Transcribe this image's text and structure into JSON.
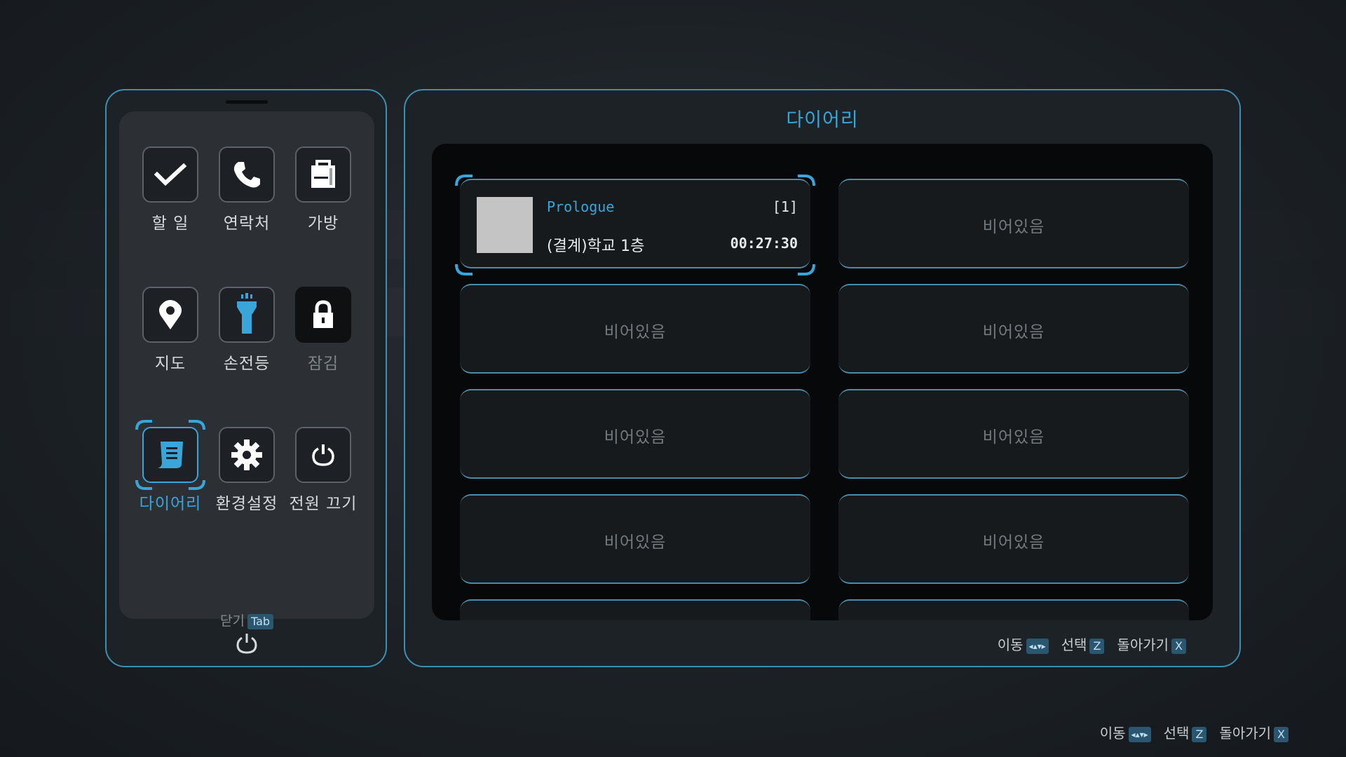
{
  "phone": {
    "apps": [
      {
        "label": "할 일",
        "icon": "checkmark-icon",
        "state": "normal"
      },
      {
        "label": "연락처",
        "icon": "phone-icon",
        "state": "normal"
      },
      {
        "label": "가방",
        "icon": "bag-icon",
        "state": "normal"
      },
      {
        "label": "지도",
        "icon": "map-pin-icon",
        "state": "normal"
      },
      {
        "label": "손전등",
        "icon": "flashlight-icon",
        "state": "normal"
      },
      {
        "label": "잠김",
        "icon": "lock-icon",
        "state": "locked"
      },
      {
        "label": "다이어리",
        "icon": "diary-icon",
        "state": "selected"
      },
      {
        "label": "환경설정",
        "icon": "gear-icon",
        "state": "normal"
      },
      {
        "label": "전원 끄기",
        "icon": "power-icon",
        "state": "normal"
      }
    ],
    "close_label": "닫기",
    "close_key": "Tab"
  },
  "diary": {
    "title": "다이어리",
    "filled_slot": {
      "chapter": "Prologue",
      "slot_number": "[1]",
      "location": "(결계)학교 1층",
      "playtime": "00:27:30"
    },
    "empty_label": "비어있음"
  },
  "hints": {
    "move_label": "이동",
    "move_key": "◂▴▾▸",
    "select_label": "선택",
    "select_key": "Z",
    "back_label": "돌아가기",
    "back_key": "X"
  },
  "colors": {
    "accent": "#3aa5d8",
    "frame": "#3d8fb0",
    "background": "#1c2126"
  }
}
